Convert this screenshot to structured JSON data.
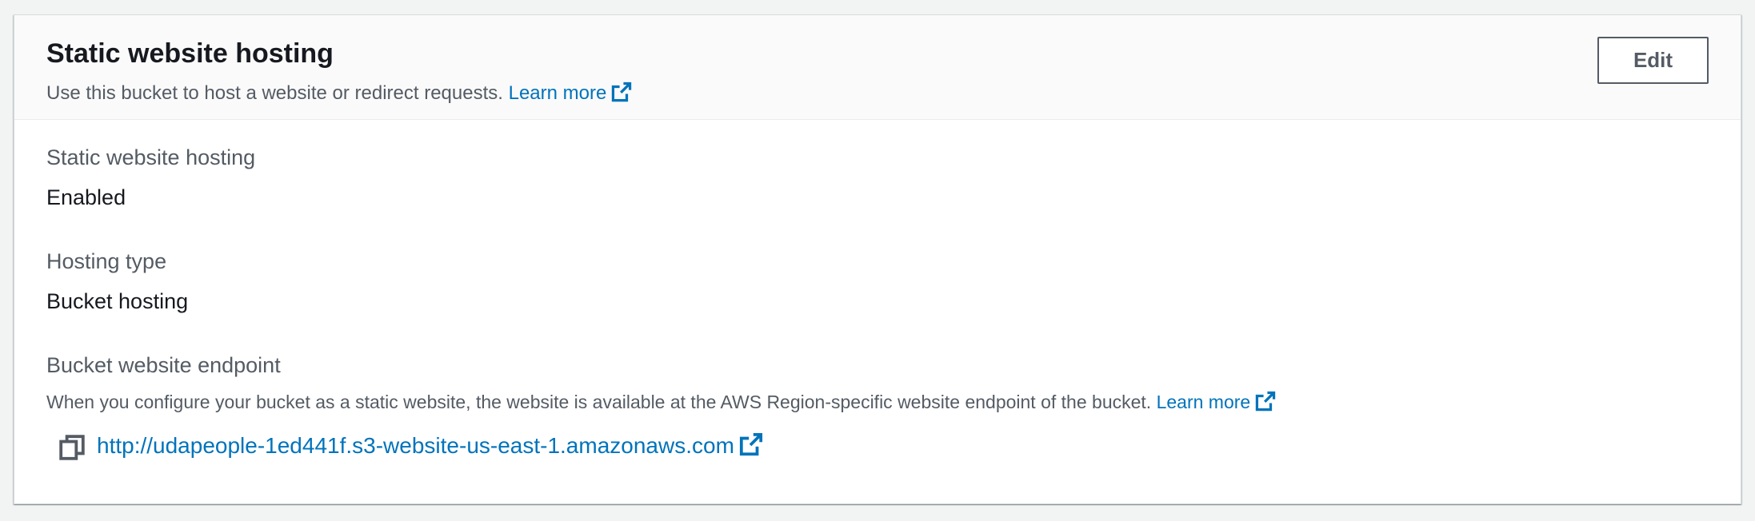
{
  "header": {
    "title": "Static website hosting",
    "description": "Use this bucket to host a website or redirect requests.",
    "learn_more": "Learn more",
    "edit_label": "Edit"
  },
  "fields": {
    "hosting": {
      "label": "Static website hosting",
      "value": "Enabled"
    },
    "hosting_type": {
      "label": "Hosting type",
      "value": "Bucket hosting"
    },
    "endpoint": {
      "label": "Bucket website endpoint",
      "description": "When you configure your bucket as a static website, the website is available at the AWS Region-specific website endpoint of the bucket.",
      "learn_more": "Learn more",
      "url": "http://udapeople-1ed441f.s3-website-us-east-1.amazonaws.com"
    }
  },
  "icons": {
    "external_link": "external-link-icon",
    "copy": "copy-icon"
  },
  "colors": {
    "link": "#0073bb",
    "title": "#16191f",
    "secondary_text": "#545b64",
    "header_bg": "#fafafa",
    "page_bg": "#f2f3f3"
  }
}
